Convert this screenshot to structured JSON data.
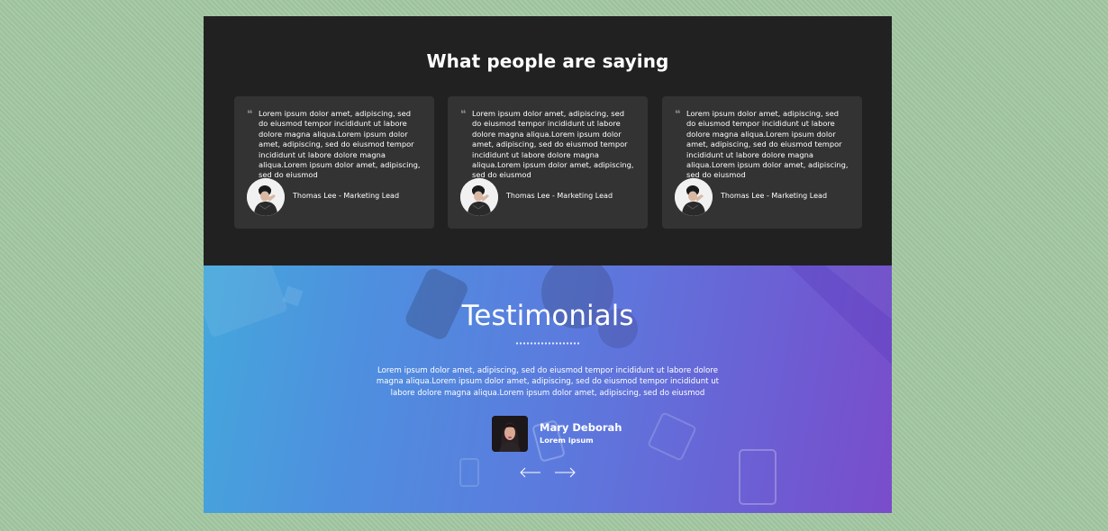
{
  "top_section": {
    "title": "What people are saying",
    "cards": [
      {
        "quote_mark": "❝",
        "text": "Lorem ipsum dolor amet, adipiscing, sed do eiusmod tempor incididunt ut labore dolore magna aliqua.Lorem ipsum dolor amet, adipiscing, sed do eiusmod tempor incididunt ut labore dolore magna aliqua.Lorem ipsum dolor amet, adipiscing, sed do eiusmod",
        "author": "Thomas Lee - Marketing Lead",
        "avatar_icon": "person-avatar"
      },
      {
        "quote_mark": "❝",
        "text": "Lorem ipsum dolor amet, adipiscing, sed do eiusmod tempor incididunt ut labore dolore magna aliqua.Lorem ipsum dolor amet, adipiscing, sed do eiusmod tempor incididunt ut labore dolore magna aliqua.Lorem ipsum dolor amet, adipiscing, sed do eiusmod",
        "author": "Thomas Lee - Marketing Lead",
        "avatar_icon": "person-avatar"
      },
      {
        "quote_mark": "❝",
        "text": "Lorem ipsum dolor amet, adipiscing, sed do eiusmod tempor incididunt ut labore dolore magna aliqua.Lorem ipsum dolor amet, adipiscing, sed do eiusmod tempor incididunt ut labore dolore magna aliqua.Lorem ipsum dolor amet, adipiscing, sed do eiusmod",
        "author": "Thomas Lee - Marketing Lead",
        "avatar_icon": "person-avatar"
      }
    ]
  },
  "testimonials": {
    "title": "Testimonials",
    "text": "Lorem ipsum dolor amet, adipiscing, sed do eiusmod tempor incididunt ut labore dolore magna aliqua.Lorem ipsum dolor amet, adipiscing, sed do eiusmod tempor incididunt ut labore dolore magna aliqua.Lorem ipsum dolor amet, adipiscing, sed do eiusmod",
    "person": {
      "name": "Mary Deborah",
      "role": "Lorem ipsum"
    },
    "nav": {
      "prev_icon": "arrow-left-icon",
      "next_icon": "arrow-right-icon"
    }
  },
  "colors": {
    "page_background": "#a3c7a2",
    "dark_section": "#212121",
    "card_background": "#333333",
    "gradient_start": "#44a7db",
    "gradient_end": "#7a4ccb"
  }
}
